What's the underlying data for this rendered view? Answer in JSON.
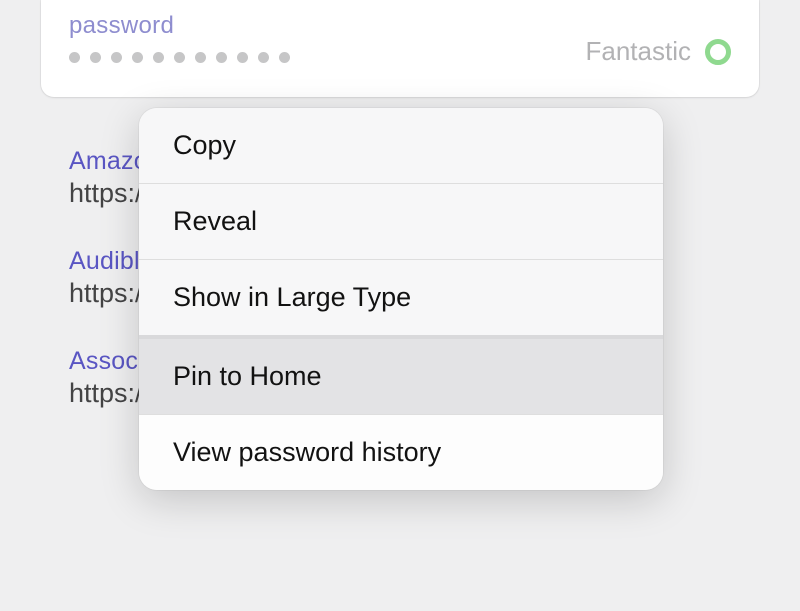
{
  "password_field": {
    "label": "password",
    "dot_count": 11,
    "strength_label": "Fantastic"
  },
  "sites": [
    {
      "title": "Amazon",
      "url": "https://amazon"
    },
    {
      "title": "Audible",
      "url": "https://audible"
    },
    {
      "title": "Associated",
      "url": "https://associated"
    }
  ],
  "menu": {
    "copy": "Copy",
    "reveal": "Reveal",
    "large_type": "Show in Large Type",
    "pin": "Pin to Home",
    "history": "View password history"
  }
}
